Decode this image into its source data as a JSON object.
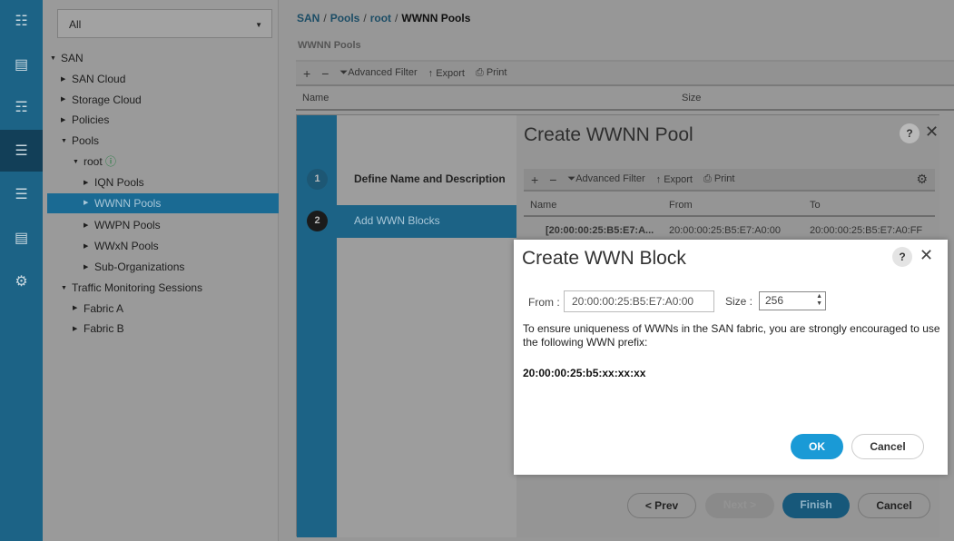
{
  "rail": {
    "icons": [
      "network-icon",
      "server-icon",
      "lan-icon",
      "san-icon",
      "vm-icon",
      "storage-icon",
      "admin-icon"
    ],
    "active_index": 3
  },
  "nav": {
    "filter": "All",
    "tree": [
      {
        "label": "SAN",
        "depth": 0,
        "expanded": true
      },
      {
        "label": "SAN Cloud",
        "depth": 1
      },
      {
        "label": "Storage Cloud",
        "depth": 1
      },
      {
        "label": "Policies",
        "depth": 1
      },
      {
        "label": "Pools",
        "depth": 1,
        "expanded": true
      },
      {
        "label": "root",
        "depth": 2,
        "expanded": true
      },
      {
        "label": "IQN Pools",
        "depth": 3
      },
      {
        "label": "WWNN Pools",
        "depth": 3,
        "selected": true
      },
      {
        "label": "WWPN Pools",
        "depth": 3
      },
      {
        "label": "WWxN Pools",
        "depth": 3
      },
      {
        "label": "Sub-Organizations",
        "depth": 3
      },
      {
        "label": "Traffic Monitoring Sessions",
        "depth": 1,
        "expanded": true
      },
      {
        "label": "Fabric A",
        "depth": 2
      },
      {
        "label": "Fabric B",
        "depth": 2
      }
    ]
  },
  "breadcrumb": [
    "SAN",
    "Pools",
    "root",
    "WWNN Pools"
  ],
  "section_title": "WWNN Pools",
  "toolbar": {
    "add": "+",
    "remove": "−",
    "filter": "Advanced Filter",
    "export": "Export",
    "print": "Print"
  },
  "table": {
    "columns": [
      "Name",
      "Size"
    ]
  },
  "wizard": {
    "title": "Create WWNN Pool",
    "help": "?",
    "close": "✕",
    "steps": [
      {
        "num": "1",
        "label": "Define Name and Description"
      },
      {
        "num": "2",
        "label": "Add WWN Blocks"
      }
    ],
    "table": {
      "columns": [
        "Name",
        "From",
        "To"
      ],
      "rows": [
        [
          "[20:00:00:25:B5:E7:A...",
          "20:00:00:25:B5:E7:A0:00",
          "20:00:00:25:B5:E7:A0:FF"
        ]
      ]
    },
    "buttons": {
      "prev": "< Prev",
      "next": "Next >",
      "finish": "Finish",
      "cancel": "Cancel"
    }
  },
  "dialog": {
    "title": "Create WWN Block",
    "help": "?",
    "close": "✕",
    "from_label": "From :",
    "from_value": "20:00:00:25:B5:E7:A0:00",
    "size_label": "Size :",
    "size_value": "256",
    "message": "To ensure uniqueness of WWNs in the SAN fabric, you are strongly encouraged to use the following WWN prefix:",
    "prefix": "20:00:00:25:b5:xx:xx:xx",
    "ok": "OK",
    "cancel": "Cancel"
  },
  "colors": {
    "accent": "#1c6386",
    "ok_button": "#1a9ad6"
  }
}
